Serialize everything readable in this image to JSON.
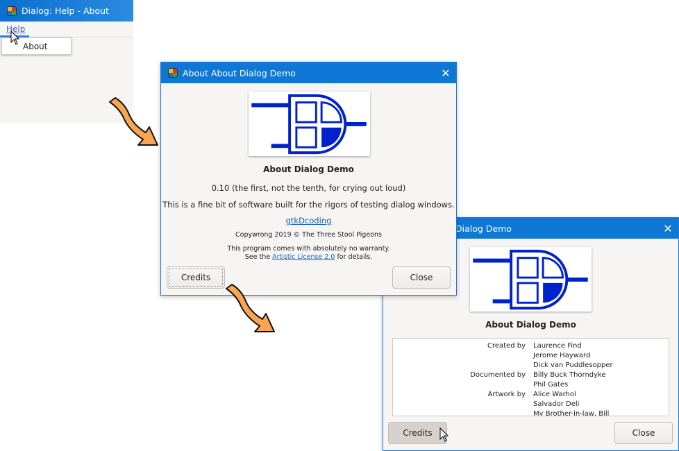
{
  "main_window": {
    "title": "Dialog: Help - About",
    "menu": {
      "help": "Help",
      "items": [
        "About"
      ]
    }
  },
  "about_dialog": {
    "title": "About About Dialog Demo",
    "program_name": "About Dialog Demo",
    "version": "0.10 (the first, not the tenth, for crying out loud)",
    "comments": "This is a fine bit of software built for the rigors of testing dialog windows.",
    "website": "gtkDcoding",
    "copyright": "Copywrong 2019 © The Three Stool Pigeons",
    "warranty_line1": "This program comes with absolutely no warranty.",
    "warranty_pre": "See the ",
    "license_link": "Artistic License 2.0",
    "warranty_post": " for details.",
    "credits_button": "Credits",
    "close_button": "Close"
  },
  "credits_dialog": {
    "title": "About About Dialog Demo",
    "visible_title": "Dialog Demo",
    "program_name": "About Dialog Demo",
    "credits": [
      {
        "role": "Created by",
        "name": "Laurence Find"
      },
      {
        "role": "",
        "name": "Jerome Hayward"
      },
      {
        "role": "",
        "name": "Dick van Puddlesopper"
      },
      {
        "role": "Documented by",
        "name": "Billy Buck Thorndyke"
      },
      {
        "role": "",
        "name": "Phil Gates"
      },
      {
        "role": "Artwork by",
        "name": "Alice Warhol"
      },
      {
        "role": "",
        "name": "Salvador Deli"
      },
      {
        "role": "",
        "name": "My Brother-in-law, Bill"
      }
    ],
    "credits_button": "Credits",
    "close_button": "Close"
  },
  "colors": {
    "titlebar": "#0f78d6",
    "logo_blue": "#0022cc",
    "arrow": "#f9a552"
  },
  "icons": [
    "app-icon",
    "close-icon",
    "arrow-icon",
    "mouse-pointer-icon"
  ]
}
